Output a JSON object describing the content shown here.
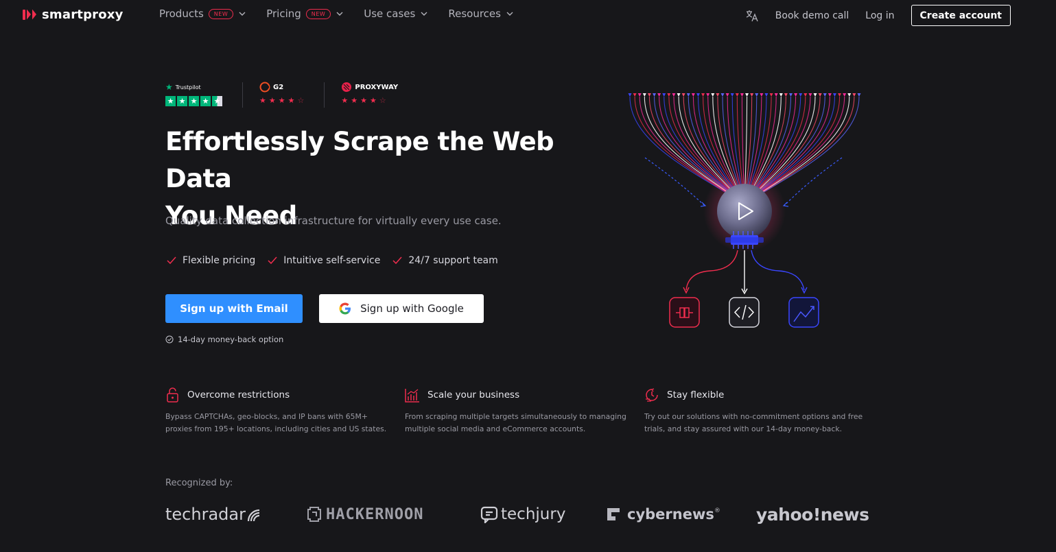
{
  "nav": {
    "logo_text": "smartproxy",
    "menu": [
      {
        "label": "Products",
        "badge": "NEW"
      },
      {
        "label": "Pricing",
        "badge": "NEW"
      },
      {
        "label": "Use cases",
        "badge": ""
      },
      {
        "label": "Resources",
        "badge": ""
      }
    ],
    "book_demo": "Book demo call",
    "login": "Log in",
    "create_account": "Create account",
    "icons": {
      "language": "translate-icon",
      "dropdown": "chevron-down-icon"
    }
  },
  "ratings": {
    "trustpilot": {
      "name": "Trustpilot",
      "stars": 4.5
    },
    "g2": {
      "name": "G2",
      "stars": 4.5
    },
    "proxyway": {
      "name": "PROXYWAY",
      "stars": 4.5
    }
  },
  "hero": {
    "title_line1": "Effortlessly Scrape the Web Data",
    "title_line2": "You Need",
    "subtitle": "Quality data collection infrastructure for virtually every use case.",
    "features": [
      "Flexible pricing",
      "Intuitive self-service",
      "24/7 support team"
    ],
    "cta_email": "Sign up with Email",
    "cta_google": "Sign up with Google",
    "money_back": "14-day money-back option"
  },
  "benefits": [
    {
      "title": "Overcome restrictions",
      "text": "Bypass CAPTCHAs, geo-blocks, and IP bans with 65M+ proxies from 195+ locations, including cities and US states.",
      "icon": "unlock-icon"
    },
    {
      "title": "Scale your business",
      "text": "From scraping multiple targets simultaneously to managing multiple social media and eCommerce accounts.",
      "icon": "growth-chart-icon"
    },
    {
      "title": "Stay flexible",
      "text": "Try out our solutions with no-commitment options and free trials, and stay assured with our 14-day money-back.",
      "icon": "clock-refresh-icon"
    }
  ],
  "recognized": {
    "label": "Recognized by:",
    "logos": [
      "techradar",
      "HACKERNOON",
      "techjury",
      "cybernews",
      "yahoo!news"
    ]
  },
  "colors": {
    "background": "#17171a",
    "accent_red": "#f02d4e",
    "accent_blue": "#2f8fff",
    "trustpilot_green": "#00b67a"
  }
}
